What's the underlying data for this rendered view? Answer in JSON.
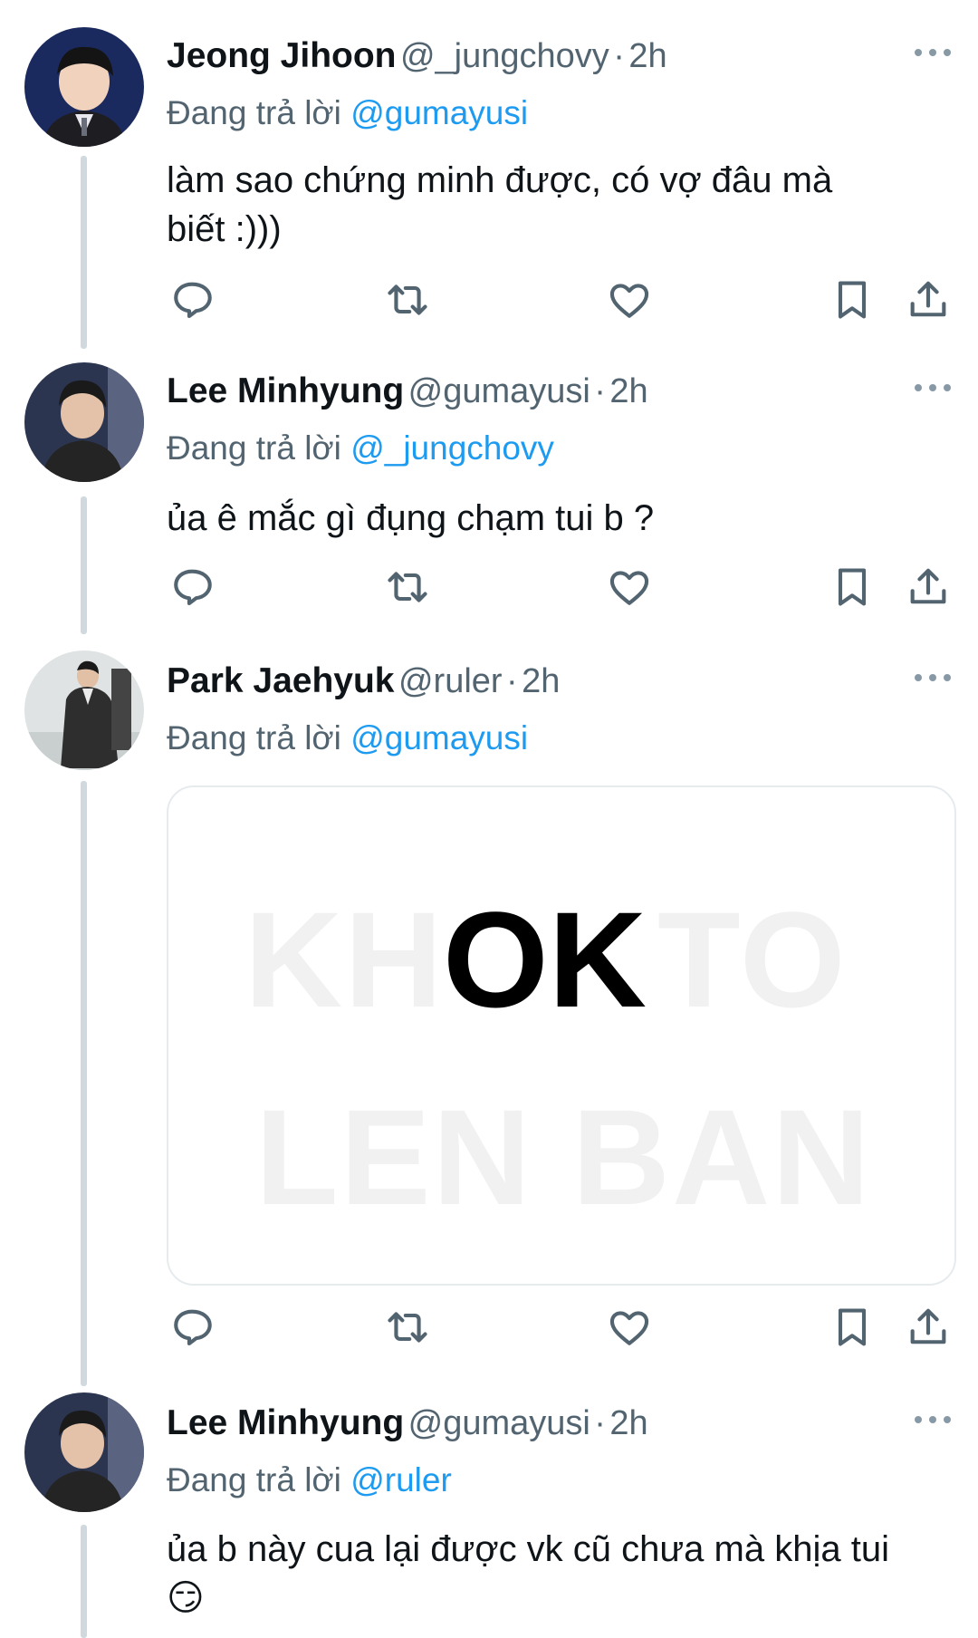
{
  "tweets": [
    {
      "name": "Jeong Jihoon",
      "handle": "@_jungchovy",
      "separator": "·",
      "time": "2h",
      "replying_prefix": "Đang trả lời",
      "replying_to": "@gumayusi",
      "text_line1": "làm sao chứng minh được, có vợ đâu mà",
      "text_line2": "biết :)))"
    },
    {
      "name": "Lee Minhyung",
      "handle": "@gumayusi",
      "separator": "·",
      "time": "2h",
      "replying_prefix": "Đang trả lời",
      "replying_to": "@_jungchovy",
      "text_line1": "ủa ê mắc gì đụng chạm tui b ?"
    },
    {
      "name": "Park Jaehyuk",
      "handle": "@ruler",
      "separator": "·",
      "time": "2h",
      "replying_prefix": "Đang trả lời",
      "replying_to": "@gumayusi",
      "media": {
        "line1_prefix": "KH",
        "line1_bold": "OK",
        "line1_suffix": "TO",
        "line2": "LEN BAN"
      }
    },
    {
      "name": "Lee Minhyung",
      "handle": "@gumayusi",
      "separator": "·",
      "time": "2h",
      "replying_prefix": "Đang trả lời",
      "replying_to": "@ruler",
      "text_line1": "ủa b này cua lại được vk cũ chưa mà khịa tui",
      "text_line2": "😏"
    }
  ],
  "colors": {
    "link": "#1d9bf0",
    "secondary_text": "#536471",
    "thread_line": "#cfd9de",
    "icon": "#536471"
  },
  "icons": [
    "reply-icon",
    "retweet-icon",
    "like-icon",
    "bookmark-icon",
    "share-icon",
    "more-icon"
  ]
}
